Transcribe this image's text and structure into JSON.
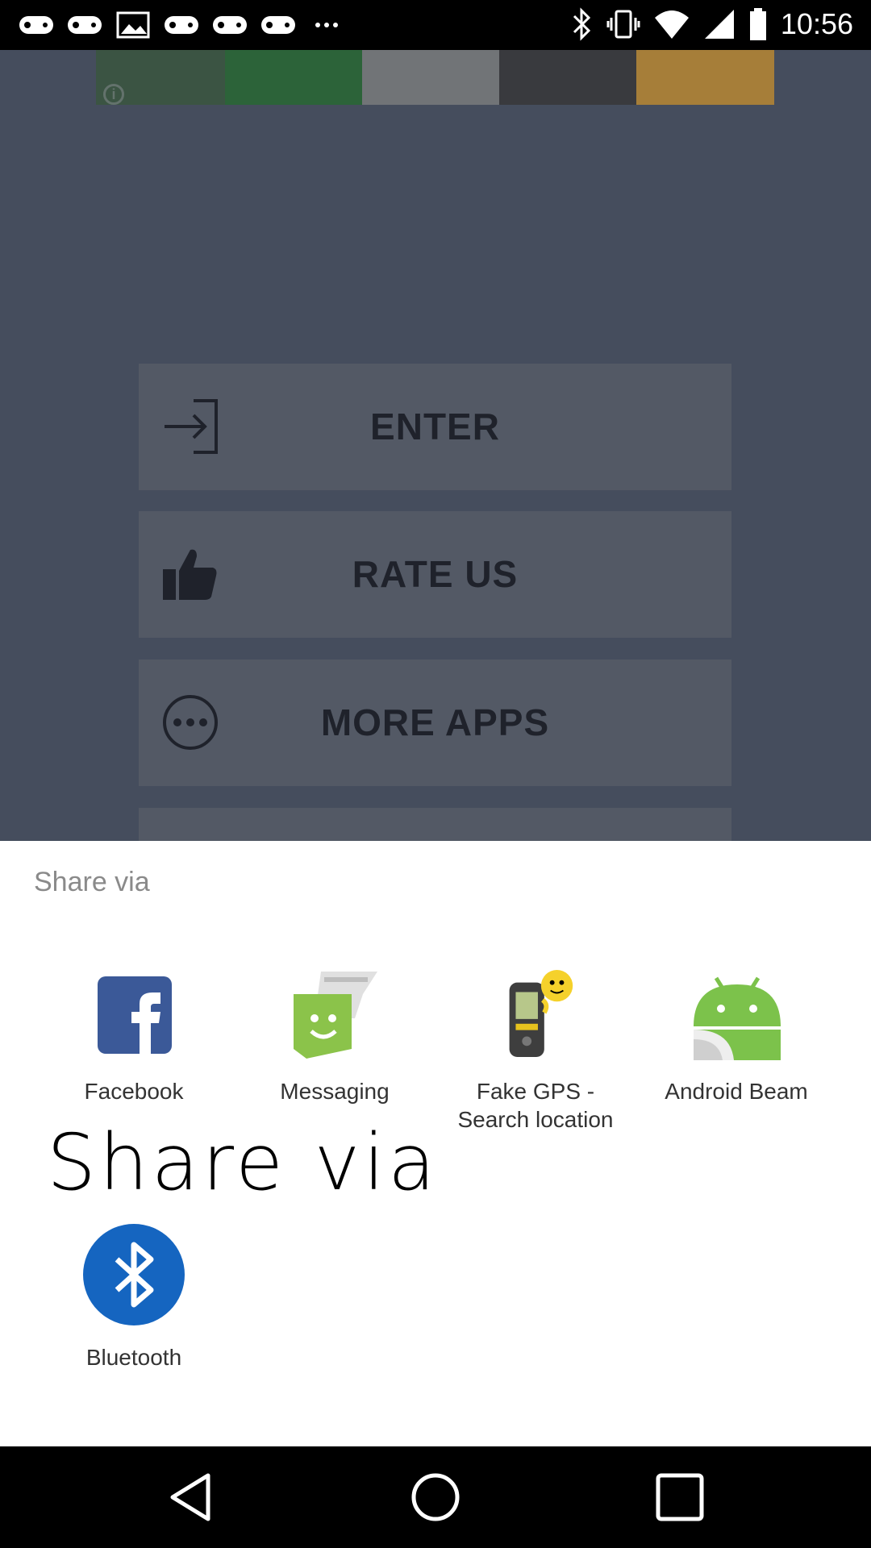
{
  "status_bar": {
    "time": "10:56",
    "left_icons": [
      "gamepad-icon",
      "gamepad-icon",
      "image-icon",
      "gamepad-icon",
      "gamepad-icon",
      "gamepad-icon",
      "dots-icon"
    ],
    "right_icons": [
      "bluetooth-icon",
      "vibrate-icon",
      "wifi-icon",
      "signal-icon",
      "battery-icon"
    ]
  },
  "background_app": {
    "ad_banner_icon": "info-icon",
    "menu": [
      {
        "label": "ENTER",
        "icon": "enter-arrow-icon"
      },
      {
        "label": "RATE US",
        "icon": "thumbs-up-icon"
      },
      {
        "label": "MORE APPS",
        "icon": "more-dots-icon"
      }
    ]
  },
  "share_sheet": {
    "title": "Share via",
    "apps": [
      {
        "label": "Facebook",
        "icon": "facebook-icon"
      },
      {
        "label": "Messaging",
        "icon": "messaging-icon"
      },
      {
        "label": "Fake GPS - Search location",
        "icon": "gps-device-icon"
      },
      {
        "label": "Android Beam",
        "icon": "android-icon"
      },
      {
        "label": "Bluetooth",
        "icon": "bluetooth-icon"
      }
    ]
  },
  "overlay_text": "Share via",
  "nav_bar": {
    "buttons": [
      "back-icon",
      "home-icon",
      "recents-icon"
    ]
  },
  "colors": {
    "facebook": "#3b5998",
    "messaging": "#8bc34a",
    "android": "#7cc24b",
    "bluetooth": "#1565c0"
  }
}
